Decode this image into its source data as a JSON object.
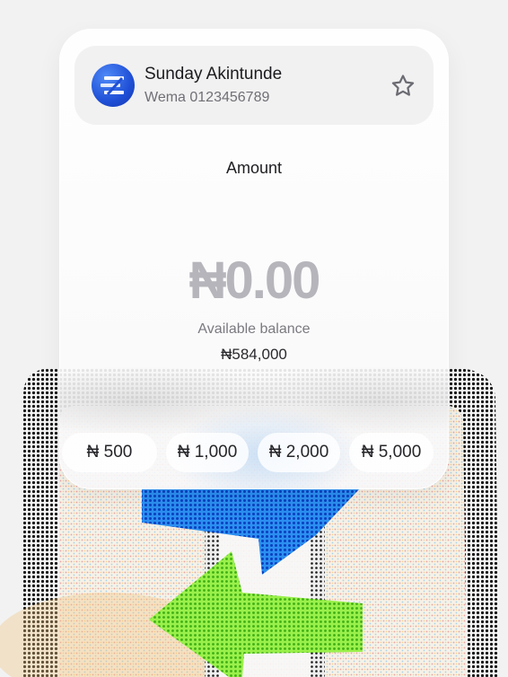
{
  "recipient": {
    "name": "Sunday Akintunde",
    "account": "Wema 0123456789",
    "favorite_icon": "star-icon",
    "avatar_icon": "wema-logo"
  },
  "amount": {
    "label": "Amount",
    "value": "₦0.00"
  },
  "balance": {
    "label": "Available balance",
    "value": "₦584,000"
  },
  "quick_amounts": [
    "₦ 500",
    "₦ 1,000",
    "₦ 2,000",
    "₦ 5,000"
  ],
  "colors": {
    "accent_blue": "#1f7de8",
    "accent_green": "#7fe23a",
    "avatar_blue": "#1f4fd6"
  }
}
